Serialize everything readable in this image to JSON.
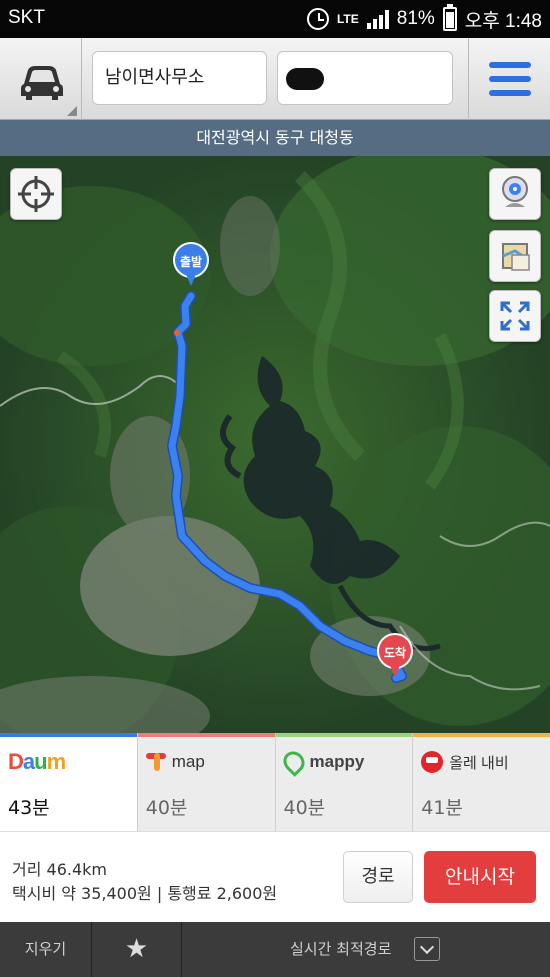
{
  "status_bar": {
    "carrier": "SKT",
    "network": "LTE",
    "battery": "81%",
    "time": "오후 1:48"
  },
  "header": {
    "origin_value": "남이면사무소",
    "destination_value": "",
    "car_icon": "car-icon",
    "menu_icon": "hamburger-menu-icon"
  },
  "location_label": "대전광역시 동구 대청동",
  "map": {
    "start_pin_label": "출발",
    "end_pin_label": "도착",
    "colors": {
      "route": "#3b82f0",
      "start_pin": "#3a7fe6",
      "end_pin": "#e5474f"
    }
  },
  "providers": [
    {
      "name": "Daum",
      "time": "43분",
      "accent": "#2f7fe6",
      "active": true
    },
    {
      "name": "map",
      "time": "40분",
      "accent": "#ef7b7b",
      "active": false
    },
    {
      "name": "mappy",
      "time": "40분",
      "accent": "#9ad37f",
      "active": false
    },
    {
      "name": "올레 내비",
      "time": "41분",
      "accent": "#f0b14a",
      "active": false
    }
  ],
  "summary": {
    "distance": "거리 46.4km",
    "fare": "택시비 약 35,400원 | 통행료 2,600원",
    "route_button": "경로",
    "start_button": "안내시작"
  },
  "bottom_bar": {
    "clear": "지우기",
    "favorite_icon": "star-icon",
    "mode": "실시간 최적경로"
  }
}
